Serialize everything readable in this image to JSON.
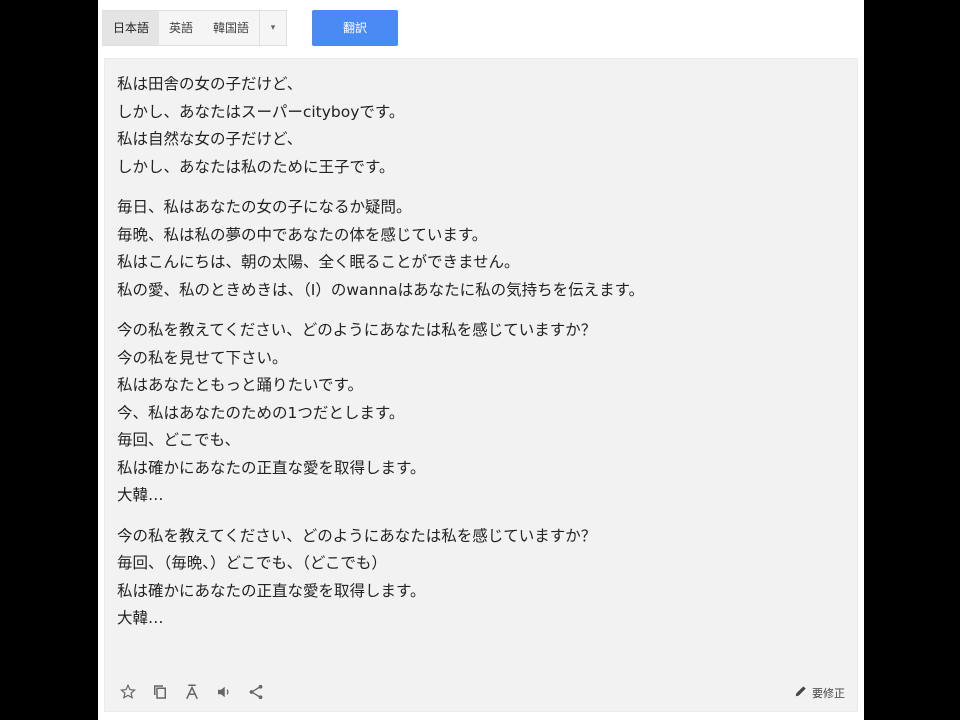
{
  "toolbar": {
    "languages": [
      "日本語",
      "英語",
      "韓国語"
    ],
    "active_language": 0,
    "dropdown_glyph": "▾",
    "translate_label": "翻訳",
    "translate_color": "#4a8af4"
  },
  "result": {
    "paragraphs": [
      [
        "私は田舎の女の子だけど、",
        "しかし、あなたはスーパーcityboyです。",
        "私は自然な女の子だけど、",
        "しかし、あなたは私のために王子です。"
      ],
      [
        "毎日、私はあなたの女の子になるか疑問。",
        "毎晩、私は私の夢の中であなたの体を感じています。",
        "私はこんにちは、朝の太陽、全く眠ることができません。",
        "私の愛、私のときめきは、（I）のwannaはあなたに私の気持ちを伝えます。"
      ],
      [
        "今の私を教えてください、どのようにあなたは私を感じていますか？",
        "今の私を見せて下さい。",
        "私はあなたともっと踊りたいです。",
        "今、私はあなたのための1つだとします。",
        "毎回、どこでも、",
        "私は確かにあなたの正直な愛を取得します。",
        "大韓…"
      ],
      [
        "今の私を教えてください、どのようにあなたは私を感じていますか？",
        "毎回、（毎晩、）どこでも、（どこでも）",
        "私は確かにあなたの正直な愛を取得します。",
        "大韓…"
      ]
    ]
  },
  "actions": {
    "icons": [
      "star-icon",
      "copy-icon",
      "phonetic-icon",
      "speaker-icon",
      "share-icon"
    ],
    "edit_label": "要修正"
  }
}
